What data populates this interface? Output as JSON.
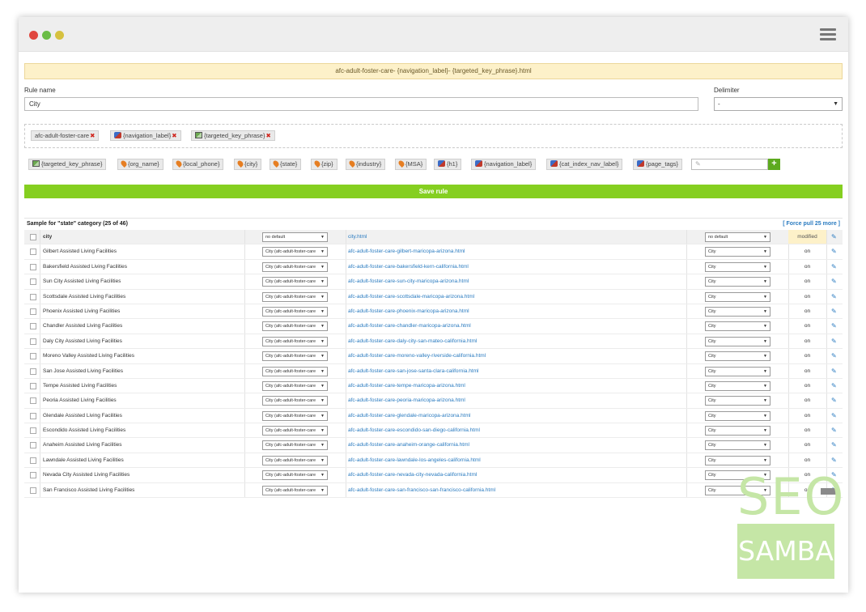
{
  "banner": {
    "pattern": "afc-adult-foster-care- {navigation_label}- {targeted_key_phrase}.html"
  },
  "form": {
    "rule_name_label": "Rule name",
    "rule_name_value": "City",
    "delimiter_label": "Delimiter",
    "delimiter_value": "-"
  },
  "selected_tokens": [
    {
      "label": "afc-adult-foster-care",
      "icon": "none"
    },
    {
      "label": "{navigation_label}",
      "icon": "cube-icon"
    },
    {
      "label": "{targeted_key_phrase}",
      "icon": "flag-icon"
    }
  ],
  "palette_tokens": [
    {
      "label": "{targeted_key_phrase}",
      "icon": "flag-icon"
    },
    {
      "label": "{org_name}",
      "icon": "pin-icon"
    },
    {
      "label": "{local_phone}",
      "icon": "pin-icon"
    },
    {
      "label": "{city}",
      "icon": "pin-icon"
    },
    {
      "label": "{state}",
      "icon": "pin-icon"
    },
    {
      "label": "{zip}",
      "icon": "pin-icon"
    },
    {
      "label": "{industry}",
      "icon": "pin-icon"
    },
    {
      "label": "{MSA}",
      "icon": "pin-icon"
    },
    {
      "label": "{h1}",
      "icon": "cube-icon"
    },
    {
      "label": "{navigation_label}",
      "icon": "cube-icon"
    },
    {
      "label": "{cat_index_nav_label}",
      "icon": "cube-icon"
    },
    {
      "label": "{page_tags}",
      "icon": "cube-icon"
    }
  ],
  "add_button": "+",
  "save_button": "Save rule",
  "table": {
    "sample_info": "Sample for \"state\" category (25 of 46)",
    "force_pull": "[ Force pull 25 more ]",
    "header": {
      "name": "city",
      "rule_select": "no default",
      "url": "city.html",
      "delim_select": "no default",
      "status": "modified"
    },
    "row_rule_select": "City (afc-adult-foster-care",
    "row_delim_select": "City",
    "row_status": "on",
    "rows": [
      {
        "name": "Gilbert Assisted Living Facilities",
        "url": "afc-adult-foster-care-gilbert-maricopa-arizona.html"
      },
      {
        "name": "Bakersfield Assisted Living Facilities",
        "url": "afc-adult-foster-care-bakersfield-kern-california.html"
      },
      {
        "name": "Sun City Assisted Living Facilities",
        "url": "afc-adult-foster-care-sun-city-maricopa-arizona.html"
      },
      {
        "name": "Scottsdale Assisted Living Facilities",
        "url": "afc-adult-foster-care-scottsdale-maricopa-arizona.html"
      },
      {
        "name": "Phoenix Assisted Living Facilities",
        "url": "afc-adult-foster-care-phoenix-maricopa-arizona.html"
      },
      {
        "name": "Chandler Assisted Living Facilities",
        "url": "afc-adult-foster-care-chandler-maricopa-arizona.html"
      },
      {
        "name": "Daly City Assisted Living Facilities",
        "url": "afc-adult-foster-care-daly-city-san-mateo-california.html"
      },
      {
        "name": "Moreno Valley Assisted Living Facilities",
        "url": "afc-adult-foster-care-moreno-valley-riverside-california.html"
      },
      {
        "name": "San Jose Assisted Living Facilities",
        "url": "afc-adult-foster-care-san-jose-santa-clara-california.html"
      },
      {
        "name": "Tempe Assisted Living Facilities",
        "url": "afc-adult-foster-care-tempe-maricopa-arizona.html"
      },
      {
        "name": "Peoria Assisted Living Facilities",
        "url": "afc-adult-foster-care-peoria-maricopa-arizona.html"
      },
      {
        "name": "Glendale Assisted Living Facilities",
        "url": "afc-adult-foster-care-glendale-maricopa-arizona.html"
      },
      {
        "name": "Escondido Assisted Living Facilities",
        "url": "afc-adult-foster-care-escondido-san-diego-california.html"
      },
      {
        "name": "Anaheim Assisted Living Facilities",
        "url": "afc-adult-foster-care-anaheim-orange-california.html"
      },
      {
        "name": "Lawndale Assisted Living Facilities",
        "url": "afc-adult-foster-care-lawndale-los-angeles-california.html"
      },
      {
        "name": "Nevada City Assisted Living Facilities",
        "url": "afc-adult-foster-care-nevada-city-nevada-california.html"
      },
      {
        "name": "San Francisco Assisted Living Facilities",
        "url": "afc-adult-foster-care-san-francisco-san-francisco-california.html"
      }
    ]
  },
  "watermark": {
    "line1": "SEO",
    "line2": "SAMBA"
  },
  "colors": {
    "accent_green": "#85cf20",
    "link_blue": "#2a7bc0",
    "banner_yellow": "#fdf1c9",
    "remove_red": "#d0251d"
  }
}
